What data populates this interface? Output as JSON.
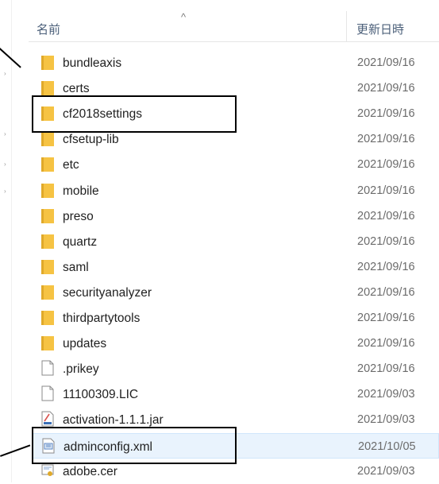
{
  "header": {
    "name_label": "名前",
    "date_label": "更新日時"
  },
  "files": [
    {
      "name": "bundleaxis",
      "date": "2021/09/16",
      "icon": "folder"
    },
    {
      "name": "certs",
      "date": "2021/09/16",
      "icon": "folder"
    },
    {
      "name": "cf2018settings",
      "date": "2021/09/16",
      "icon": "folder"
    },
    {
      "name": "cfsetup-lib",
      "date": "2021/09/16",
      "icon": "folder"
    },
    {
      "name": "etc",
      "date": "2021/09/16",
      "icon": "folder"
    },
    {
      "name": "mobile",
      "date": "2021/09/16",
      "icon": "folder"
    },
    {
      "name": "preso",
      "date": "2021/09/16",
      "icon": "folder"
    },
    {
      "name": "quartz",
      "date": "2021/09/16",
      "icon": "folder"
    },
    {
      "name": "saml",
      "date": "2021/09/16",
      "icon": "folder"
    },
    {
      "name": "securityanalyzer",
      "date": "2021/09/16",
      "icon": "folder"
    },
    {
      "name": "thirdpartytools",
      "date": "2021/09/16",
      "icon": "folder"
    },
    {
      "name": "updates",
      "date": "2021/09/16",
      "icon": "folder"
    },
    {
      "name": ".prikey",
      "date": "2021/09/16",
      "icon": "file"
    },
    {
      "name": "11100309.LIC",
      "date": "2021/09/03",
      "icon": "file"
    },
    {
      "name": "activation-1.1.1.jar",
      "date": "2021/09/03",
      "icon": "jar"
    },
    {
      "name": "adminconfig.xml",
      "date": "2021/10/05",
      "icon": "xml",
      "selected": true
    },
    {
      "name": "adobe.cer",
      "date": "2021/09/03",
      "icon": "cert"
    }
  ],
  "colors": {
    "folder": "#f6c343",
    "folder_dark": "#e0a92a",
    "selection": "#e9f3fd"
  }
}
